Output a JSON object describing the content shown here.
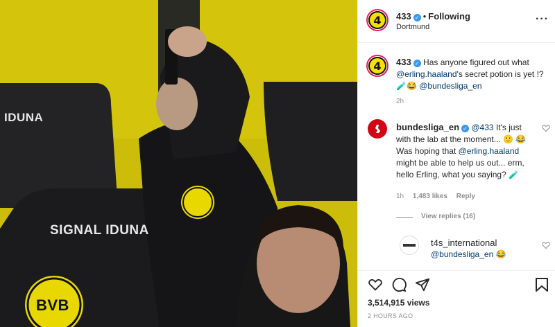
{
  "header": {
    "avatar_text": "4",
    "username": "433",
    "separator": "•",
    "follow_status": "Following",
    "location": "Dortmund",
    "more_icon": "ellipsis-icon"
  },
  "media": {
    "badges": [
      "IDUNA",
      "SIGNAL IDUNA",
      "BVB"
    ]
  },
  "caption": {
    "username": "433",
    "text_pre": "Has anyone figured out what",
    "mention": "@erling.haaland",
    "text_post": "'s secret potion is yet !?🧪😂",
    "mention2": "@bundesliga_en",
    "time": "2h"
  },
  "comments": [
    {
      "username": "bundesliga_en",
      "mention": "@433",
      "text1": "It's just with the lab at the moment... 🙂",
      "text2": "😂 Was hoping that",
      "mention2": "@erling.haaland",
      "text3": "might be able to help us out... erm, hello Erling, what you saying? 🧪",
      "time": "1h",
      "likes": "1,483 likes",
      "reply": "Reply",
      "view_replies": "View replies (16)"
    },
    {
      "username": "t4s_international",
      "mention": "@bundesliga_en",
      "emoji": "😂"
    }
  ],
  "footer": {
    "views": "3,514,915 views",
    "posted": "2 HOURS AGO"
  },
  "colors": {
    "link": "#00376b",
    "verified": "#3897f0",
    "seat_yellow": "#e8d800"
  }
}
